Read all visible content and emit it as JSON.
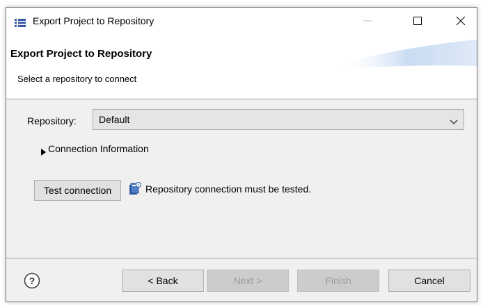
{
  "window": {
    "title": "Export Project to Repository",
    "app_icon": "wizard-icon",
    "controls": {
      "minimize": "minimize-icon",
      "maximize": "maximize-icon",
      "close": "close-icon"
    }
  },
  "header": {
    "title": "Export Project to Repository",
    "subtitle": "Select a repository to connect"
  },
  "form": {
    "repository_label": "Repository:",
    "repository_value": "Default",
    "connection_info_label": "Connection Information",
    "connection_info_expanded": false
  },
  "test": {
    "button_label": "Test connection",
    "status_icon": "info-book-icon",
    "status_text": "Repository connection must be tested."
  },
  "footer": {
    "help_icon": "help-icon",
    "back_label": "< Back",
    "next_label": "Next >",
    "finish_label": "Finish",
    "cancel_label": "Cancel",
    "next_enabled": false,
    "finish_enabled": false
  }
}
